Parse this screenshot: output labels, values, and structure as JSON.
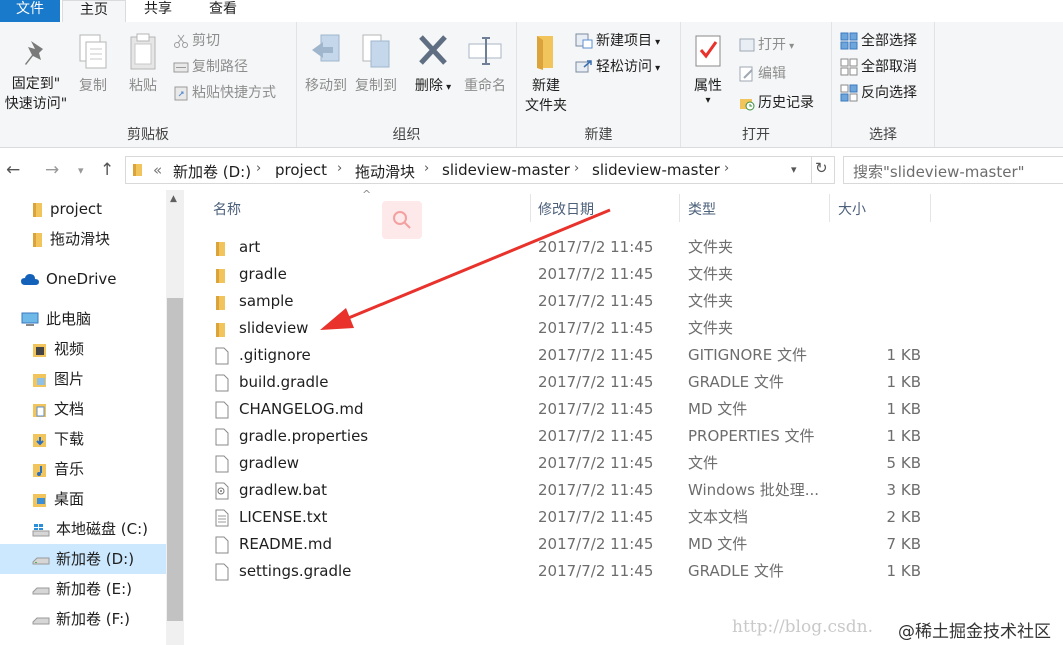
{
  "tabs": {
    "file": "文件",
    "home": "主页",
    "share": "共享",
    "view": "查看"
  },
  "ribbon": {
    "clipboard": {
      "label": "剪贴板",
      "pin_line1": "固定到\"",
      "pin_line2": "快速访问\"",
      "copy": "复制",
      "paste": "粘贴",
      "cut": "剪切",
      "copy_path": "复制路径",
      "paste_shortcut": "粘贴快捷方式"
    },
    "organize": {
      "label": "组织",
      "move_to": "移动到",
      "copy_to": "复制到",
      "delete": "删除",
      "rename": "重命名"
    },
    "new": {
      "label": "新建",
      "new_folder_line1": "新建",
      "new_folder_line2": "文件夹",
      "new_item": "新建项目",
      "easy_access": "轻松访问"
    },
    "open": {
      "label": "打开",
      "properties": "属性",
      "open": "打开",
      "edit": "编辑",
      "history": "历史记录"
    },
    "select": {
      "label": "选择",
      "select_all": "全部选择",
      "select_none": "全部取消",
      "invert": "反向选择"
    }
  },
  "address": {
    "overflow": "«",
    "crumbs": [
      "新加卷 (D:)",
      "project",
      "拖动滑块",
      "slideview-master",
      "slideview-master"
    ]
  },
  "search": {
    "placeholder": "搜索\"slideview-master\""
  },
  "nav": {
    "items": [
      {
        "label": "project",
        "icon": "folder-icon"
      },
      {
        "label": "拖动滑块",
        "icon": "folder-icon"
      },
      {
        "label": "OneDrive",
        "icon": "cloud-icon"
      },
      {
        "label": "此电脑",
        "icon": "computer-icon"
      },
      {
        "label": "视频",
        "icon": "video-folder-icon"
      },
      {
        "label": "图片",
        "icon": "pictures-folder-icon"
      },
      {
        "label": "文档",
        "icon": "documents-folder-icon"
      },
      {
        "label": "下载",
        "icon": "downloads-folder-icon"
      },
      {
        "label": "音乐",
        "icon": "music-folder-icon"
      },
      {
        "label": "桌面",
        "icon": "desktop-folder-icon"
      },
      {
        "label": "本地磁盘 (C:)",
        "icon": "windows-drive-icon"
      },
      {
        "label": "新加卷 (D:)",
        "icon": "drive-icon"
      },
      {
        "label": "新加卷 (E:)",
        "icon": "drive-icon"
      },
      {
        "label": "新加卷 (F:)",
        "icon": "drive-icon"
      }
    ]
  },
  "columns": {
    "name": "名称",
    "modified": "修改日期",
    "type": "类型",
    "size": "大小"
  },
  "files": [
    {
      "name": "art",
      "date": "2017/7/2 11:45",
      "type": "文件夹",
      "size": "",
      "icon": "folder-icon"
    },
    {
      "name": "gradle",
      "date": "2017/7/2 11:45",
      "type": "文件夹",
      "size": "",
      "icon": "folder-icon"
    },
    {
      "name": "sample",
      "date": "2017/7/2 11:45",
      "type": "文件夹",
      "size": "",
      "icon": "folder-icon"
    },
    {
      "name": "slideview",
      "date": "2017/7/2 11:45",
      "type": "文件夹",
      "size": "",
      "icon": "folder-icon"
    },
    {
      "name": ".gitignore",
      "date": "2017/7/2 11:45",
      "type": "GITIGNORE 文件",
      "size": "1 KB",
      "icon": "file-icon"
    },
    {
      "name": "build.gradle",
      "date": "2017/7/2 11:45",
      "type": "GRADLE 文件",
      "size": "1 KB",
      "icon": "file-icon"
    },
    {
      "name": "CHANGELOG.md",
      "date": "2017/7/2 11:45",
      "type": "MD 文件",
      "size": "1 KB",
      "icon": "file-icon"
    },
    {
      "name": "gradle.properties",
      "date": "2017/7/2 11:45",
      "type": "PROPERTIES 文件",
      "size": "1 KB",
      "icon": "file-icon"
    },
    {
      "name": "gradlew",
      "date": "2017/7/2 11:45",
      "type": "文件",
      "size": "5 KB",
      "icon": "file-icon"
    },
    {
      "name": "gradlew.bat",
      "date": "2017/7/2 11:45",
      "type": "Windows 批处理...",
      "size": "3 KB",
      "icon": "batch-file-icon"
    },
    {
      "name": "LICENSE.txt",
      "date": "2017/7/2 11:45",
      "type": "文本文档",
      "size": "2 KB",
      "icon": "text-file-icon"
    },
    {
      "name": "README.md",
      "date": "2017/7/2 11:45",
      "type": "MD 文件",
      "size": "7 KB",
      "icon": "file-icon"
    },
    {
      "name": "settings.gradle",
      "date": "2017/7/2 11:45",
      "type": "GRADLE 文件",
      "size": "1 KB",
      "icon": "file-icon"
    }
  ],
  "watermark": {
    "url": "http://blog.csdn.",
    "brand": "@稀土掘金技术社区"
  },
  "colors": {
    "accent": "#1979ca",
    "folder": "#e8b84a",
    "arrow": "#e8322b",
    "selection": "#cce8ff"
  }
}
